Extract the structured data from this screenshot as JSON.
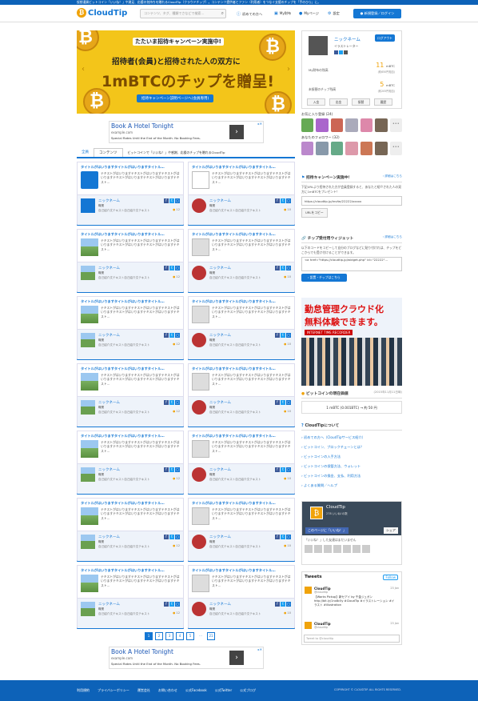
{
  "topnote": "仮想通貨ビットコイン「いいね！」や満足、応援の気持ちを贈れるCloudTip（クラウドチップ）。コンテンツ提供者とファン（利用者）をつなぐ支援のチップを「手のひら」に。",
  "header": {
    "logo_mark": "₿",
    "logo_text": "CloudTip",
    "search_placeholder": "コンテンツ、タグ、種類でさなどで検索…",
    "nav": [
      "初めての方へ",
      "My財布",
      "Myページ",
      "設定"
    ],
    "register": "新規登録／ログイン"
  },
  "banner": {
    "line1": "たたいま招待キャンペーン実施中!",
    "line2": "招待者(会員)と招待された人の双方に",
    "line3": "1mBTCのチップを贈呈!",
    "line4": "招待キャンペーン説明ページへ(会員専用)"
  },
  "ad": {
    "title": "Book A Hotel Tonight",
    "url": "example.com",
    "desc": "Special Rates Until the End of the Month. No Booking Fees."
  },
  "tabs": [
    "全員",
    "コンテンツ",
    "ビットコインで「いいね！」や感謝、応援のチップを贈れるCloudTip"
  ],
  "card": {
    "title": "タイトルがはいりますタイトルがはいりますタイトル…",
    "text": "テキストがはいりますテキストがはいりますテキストがはいりますテキストがはいりますテキストがはいりますテキスト…",
    "user": "ニックネーム",
    "role": "職業",
    "desc": "自己紹介文テキスト自己紹介文テキスト",
    "count": "12",
    "count_right": "10"
  },
  "pager": [
    "1",
    "2",
    "3",
    "4",
    "5",
    "…",
    "21"
  ],
  "profile": {
    "name": "ニックネーム",
    "role": "イラストレーター",
    "logout": "ログアウト",
    "bal_label": "My財布の残高",
    "bal_value": "11",
    "bal_unit": "mBTC",
    "bal_sub": "(約650円相当)",
    "recv_label": "未振替のチップ残高",
    "recv_value": "5",
    "recv_unit": "mBTC",
    "recv_sub": "(約205円相当)",
    "btns": [
      "入金",
      "出金",
      "振替",
      "履歴"
    ]
  },
  "fav_title": "お気に入り登録 (24)",
  "follow_title": "あなたのフォロワー (32)",
  "campaign": {
    "title": "招待キャンペーン実施中！",
    "more": "› 詳細はこちら",
    "text": "下記URLより招待された方が会員登録すると、あなたと紹介された人の双方に1mBTCをプレゼント！",
    "url": "https://cloudtip.jp/invite/22222/xxxxx",
    "copy": "URLをコピー"
  },
  "widget": {
    "title": "チップ受付用ウィジェット",
    "more": "› 詳細はこちら",
    "text": "以下のコードをコピーして自分のブログなどに貼り付けれは、チップをどこからでも受け付けることができます。",
    "code": "<a href=\"https://cloudtip.jp/widget.php\" id=\"22222\"…",
    "btn": "› 設置・チップはこちら"
  },
  "rad": {
    "l1": "勤怠管理クラウド化",
    "l2": "無料体験できます。",
    "l3": "INTERNET TIME RECORDER"
  },
  "btc": {
    "title": "ビットコインの現在価値",
    "date": "(2015年11月11日時)",
    "rate": "1 mBTC (0.001BTC) → 約 50 円"
  },
  "about": {
    "title": "CloudTipについて",
    "links": [
      "› 初めての方へ（CloudTipサービス紹介）",
      "› ビットコイン、ブロックチェーンとは？",
      "› ビットコインの入手方法",
      "› ビットコインの保管方法、ウォレット",
      "› ビットコインの換金、支払、利用方法",
      "› よくある質問／ヘルプ"
    ]
  },
  "fb": {
    "name": "CloudTip",
    "sub": "278 いいね!の数",
    "like": "このページに「いいね！」",
    "share": "シェア",
    "cap": "「いいね！」した友達はまだいません"
  },
  "tw": {
    "title": "Tweets",
    "follow": "Follow",
    "tweets": [
      {
        "name": "CloudTip",
        "handle": "@cloudtip",
        "date": "23 Jan",
        "body": "【Works Pickup】新セアイ by 千金ジュガン http://bit.ly/1nx8c5y #CloudTip #イラストレーション #イラスト #illustration"
      },
      {
        "name": "CloudTip",
        "handle": "@cloudtip",
        "date": "23 Jan",
        "body": ""
      }
    ],
    "input": "Tweet to @cloudtip"
  },
  "footer": {
    "links": [
      "利用規約",
      "プライバシーポリシー",
      "運営会社",
      "お問い合わせ",
      "公式Facebook",
      "公式Twitter",
      "公式ブログ"
    ],
    "copy": "COPYRIGHT © CLOUDTIP. ALL RIGHTS RESERVED."
  },
  "colors": {
    "accent": "#1477d4",
    "coin": "#f0a30a",
    "banner": "#f3c51a",
    "footer": "#0d62b8"
  }
}
